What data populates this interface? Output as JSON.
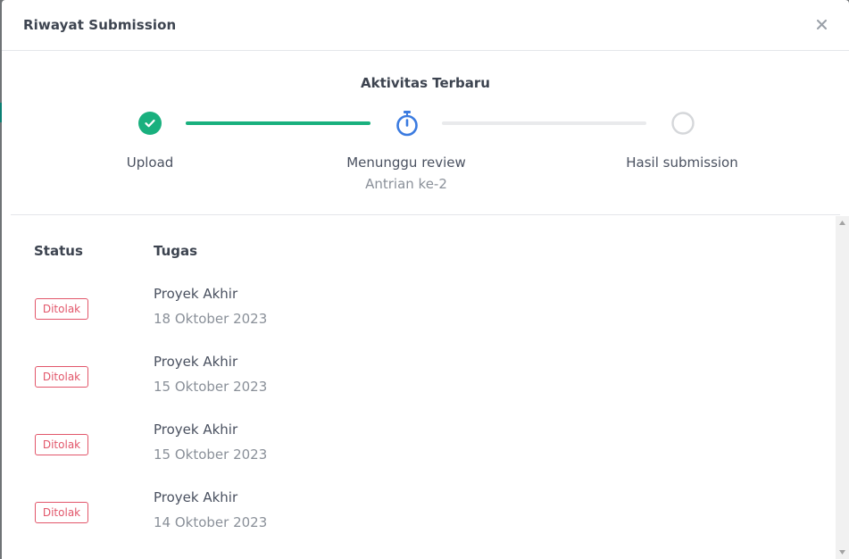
{
  "modal": {
    "title": "Riwayat Submission",
    "close_icon": "close-icon"
  },
  "activity": {
    "title": "Aktivitas Terbaru",
    "steps": [
      {
        "label": "Upload",
        "state": "done",
        "icon": "check-circle-icon"
      },
      {
        "label": "Menunggu review",
        "sublabel": "Antrian ke-2",
        "state": "active",
        "icon": "stopwatch-icon"
      },
      {
        "label": "Hasil submission",
        "state": "pending",
        "icon": "empty-circle-icon"
      }
    ],
    "colors": {
      "done": "#19b07e",
      "active": "#3b7be0",
      "pending": "#d5d7da"
    }
  },
  "history": {
    "headers": {
      "status": "Status",
      "task": "Tugas"
    },
    "rows": [
      {
        "status": "Ditolak",
        "task": "Proyek Akhir",
        "date": "18 Oktober 2023"
      },
      {
        "status": "Ditolak",
        "task": "Proyek Akhir",
        "date": "15 Oktober 2023"
      },
      {
        "status": "Ditolak",
        "task": "Proyek Akhir",
        "date": "15 Oktober 2023"
      },
      {
        "status": "Ditolak",
        "task": "Proyek Akhir",
        "date": "14 Oktober 2023"
      }
    ],
    "badge_color": "#e2566a"
  }
}
